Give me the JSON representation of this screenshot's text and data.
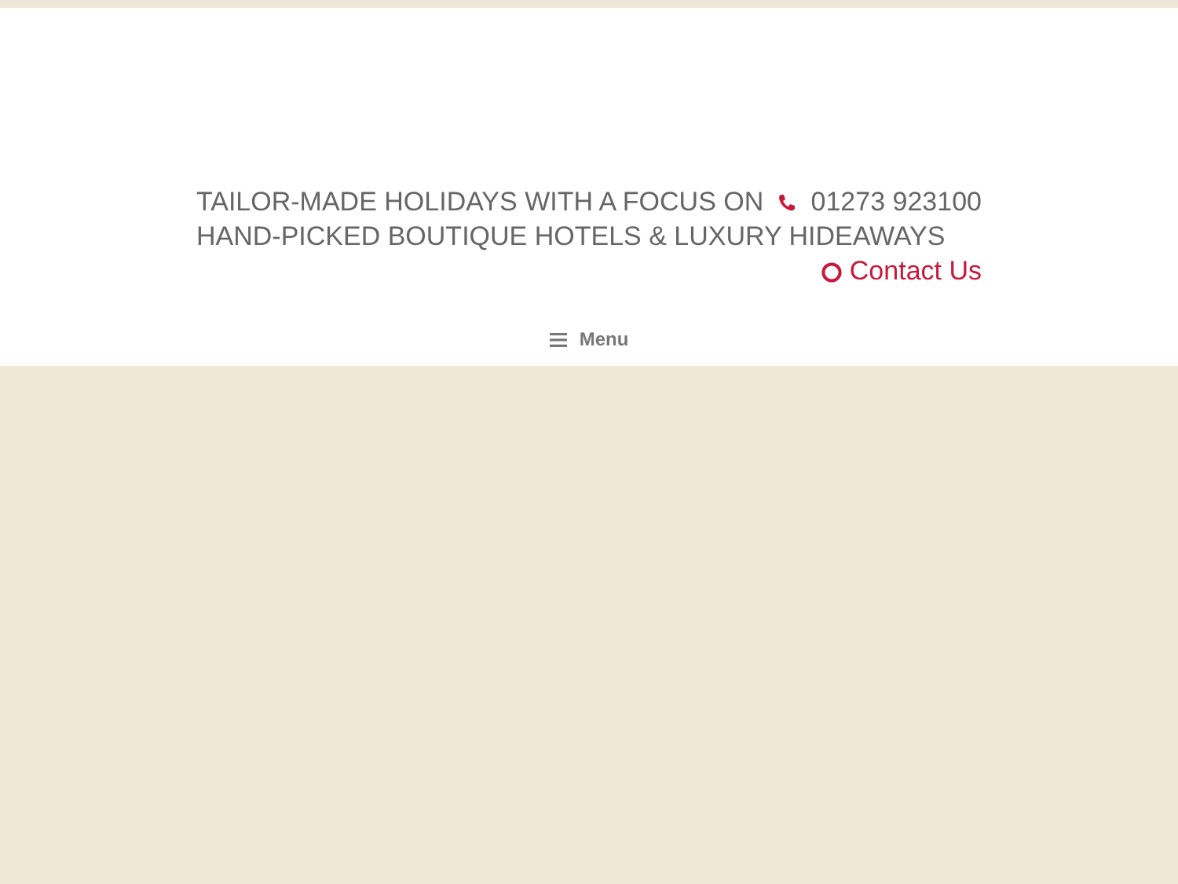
{
  "header": {
    "tagline_lines": [
      "TAILOR-MADE HOLIDAYS WITH A FOCUS ON",
      "HAND-PICKED BOUTIQUE HOTELS & LUXURY HIDEAWAYS"
    ],
    "phone": "01273 923100",
    "contact_link": "Contact Us"
  },
  "nav": {
    "menu_label": "Menu"
  }
}
